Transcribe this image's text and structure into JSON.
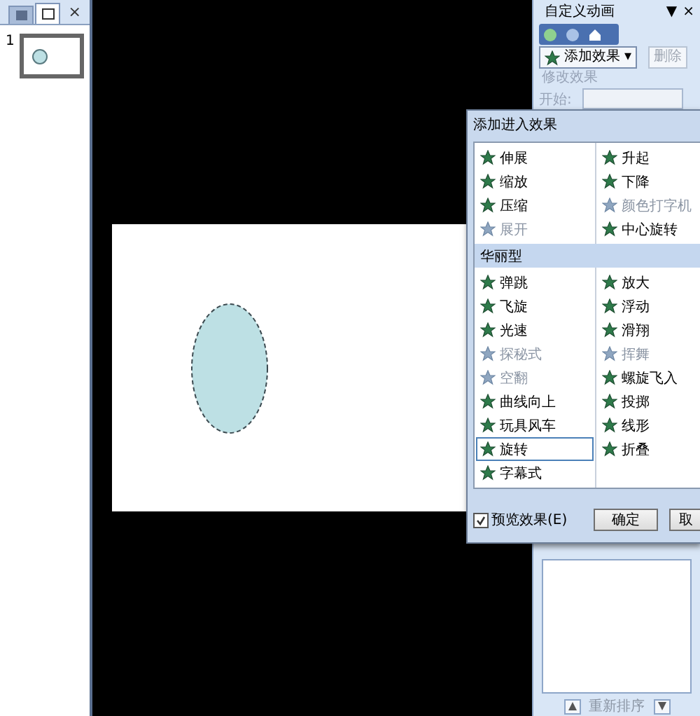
{
  "slides_pane": {
    "tabs": [
      {
        "kind": "outline",
        "selected": false
      },
      {
        "kind": "slides",
        "selected": true
      }
    ],
    "close_glyph": "×",
    "thumbnails": [
      {
        "number": "1",
        "selected": true
      }
    ]
  },
  "task_pane": {
    "title": "自定义动画",
    "menu_glyph": "▼",
    "close_glyph": "×",
    "add_effect": "添加效果",
    "add_effect_caret": "▾",
    "remove": {
      "label": "删除",
      "disabled": true
    },
    "modify_label": "修改效果",
    "start_label": "开始:",
    "reorder": "重新排序"
  },
  "dialog": {
    "title": "添加进入效果",
    "sections": [
      {
        "left": [
          {
            "label": "伸展",
            "disabled": false,
            "selected": false
          },
          {
            "label": "缩放",
            "disabled": false,
            "selected": false
          },
          {
            "label": "压缩",
            "disabled": false,
            "selected": false
          },
          {
            "label": "展开",
            "disabled": true,
            "selected": false
          }
        ],
        "right": [
          {
            "label": "升起",
            "disabled": false,
            "selected": false
          },
          {
            "label": "下降",
            "disabled": false,
            "selected": false
          },
          {
            "label": "颜色打字机",
            "disabled": true,
            "selected": false
          },
          {
            "label": "中心旋转",
            "disabled": false,
            "selected": false
          }
        ]
      },
      {
        "header": "华丽型",
        "left": [
          {
            "label": "弹跳",
            "disabled": false,
            "selected": false
          },
          {
            "label": "飞旋",
            "disabled": false,
            "selected": false
          },
          {
            "label": "光速",
            "disabled": false,
            "selected": false
          },
          {
            "label": "探秘式",
            "disabled": true,
            "selected": false
          },
          {
            "label": "空翻",
            "disabled": true,
            "selected": false
          },
          {
            "label": "曲线向上",
            "disabled": false,
            "selected": false
          },
          {
            "label": "玩具风车",
            "disabled": false,
            "selected": false
          },
          {
            "label": "旋转",
            "disabled": false,
            "selected": true
          },
          {
            "label": "字幕式",
            "disabled": false,
            "selected": false
          }
        ],
        "right": [
          {
            "label": "放大",
            "disabled": false,
            "selected": false
          },
          {
            "label": "浮动",
            "disabled": false,
            "selected": false
          },
          {
            "label": "滑翔",
            "disabled": false,
            "selected": false
          },
          {
            "label": "挥舞",
            "disabled": true,
            "selected": false
          },
          {
            "label": "螺旋飞入",
            "disabled": false,
            "selected": false
          },
          {
            "label": "投掷",
            "disabled": false,
            "selected": false
          },
          {
            "label": "线形",
            "disabled": false,
            "selected": false
          },
          {
            "label": "折叠",
            "disabled": false,
            "selected": false
          }
        ]
      }
    ],
    "preview": {
      "label": "预览效果(E)",
      "checked": true
    },
    "buttons": [
      "确定",
      "取"
    ]
  }
}
